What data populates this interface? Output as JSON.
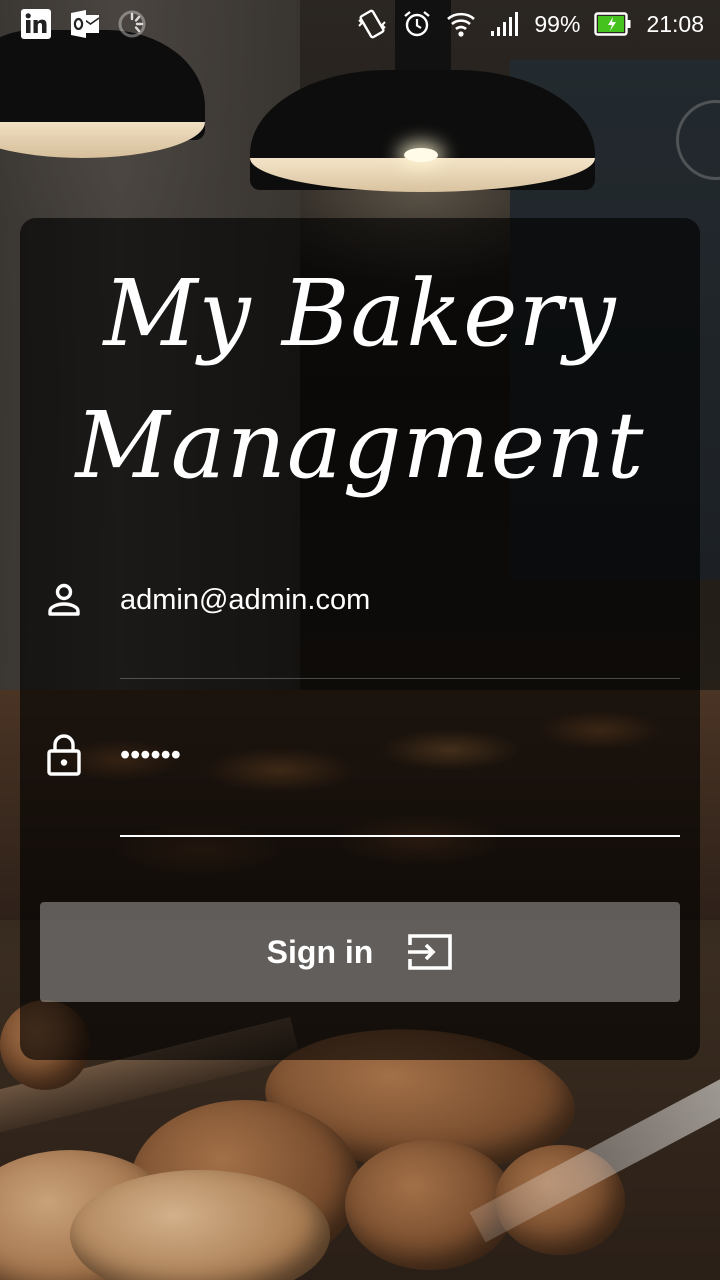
{
  "status_bar": {
    "battery_percent": "99%",
    "time": "21:08",
    "icons": [
      "linkedin-icon",
      "outlook-icon",
      "loading-icon",
      "vibrate-icon",
      "alarm-icon",
      "wifi-icon",
      "signal-icon",
      "battery-charging-icon"
    ]
  },
  "app": {
    "title_line1": "My Bakery",
    "title_line2": "Managment"
  },
  "login": {
    "email_value": "admin@admin.com",
    "password_value": "••••••",
    "email_icon": "person-icon",
    "password_icon": "lock-icon",
    "signin_label": "Sign in",
    "signin_icon": "sign-in-icon"
  }
}
